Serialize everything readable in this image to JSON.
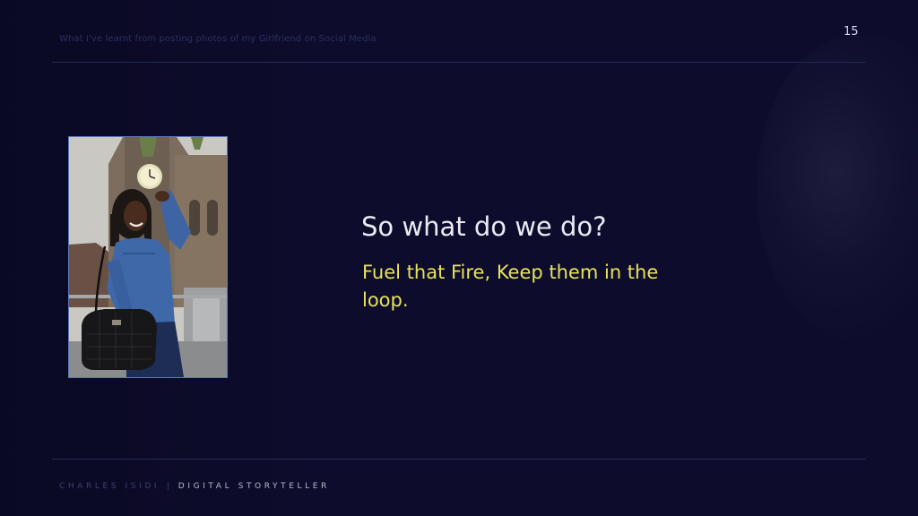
{
  "slide": {
    "header_title": "What I've learnt from posting photos of my Girlfriend on Social Media",
    "page_number": "15",
    "heading": "So what do we do?",
    "subheading": "Fuel that Fire, Keep them in the loop.",
    "photo_alt": "Woman in a denim shirt holding a black handbag in front of a church",
    "footer": {
      "name": "CHARLES ISIDI",
      "separator": "|",
      "role": "DIGITAL STORYTELLER"
    }
  },
  "colors": {
    "background": "#0d0c2c",
    "heading": "#e9eaf4",
    "subheading": "#e7e35a",
    "rule": "#252a52",
    "photo_border": "#5a78b8"
  }
}
